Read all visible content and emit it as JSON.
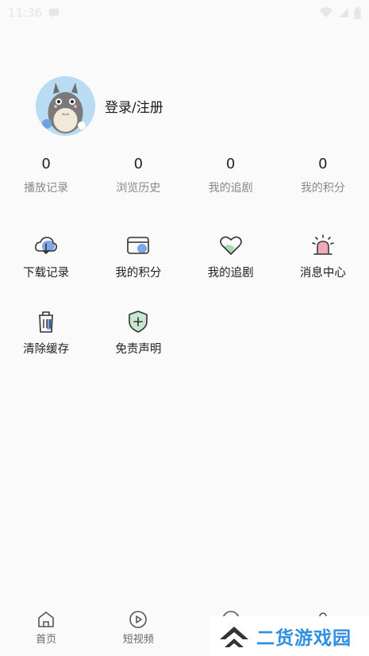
{
  "status_bar": {
    "time": "11:36"
  },
  "profile": {
    "login_label": "登录/注册"
  },
  "stats": [
    {
      "value": "0",
      "label": "播放记录"
    },
    {
      "value": "0",
      "label": "浏览历史"
    },
    {
      "value": "0",
      "label": "我的追剧"
    },
    {
      "value": "0",
      "label": "我的积分"
    }
  ],
  "grid": [
    {
      "label": "下载记录",
      "icon": "cloud-download-icon"
    },
    {
      "label": "我的积分",
      "icon": "card-icon"
    },
    {
      "label": "我的追剧",
      "icon": "heart-icon"
    },
    {
      "label": "消息中心",
      "icon": "alarm-icon"
    },
    {
      "label": "清除缓存",
      "icon": "trash-icon"
    },
    {
      "label": "免责声明",
      "icon": "shield-plus-icon"
    }
  ],
  "tabbar": [
    {
      "label": "首页",
      "icon": "home-icon"
    },
    {
      "label": "短视频",
      "icon": "play-icon"
    }
  ],
  "watermark": {
    "text": "二货游戏园"
  },
  "colors": {
    "accent_blue": "#7ea6e8",
    "accent_green": "#a8d8b0",
    "accent_pink": "#f3a8b4",
    "watermark": "#2f8fe0"
  }
}
